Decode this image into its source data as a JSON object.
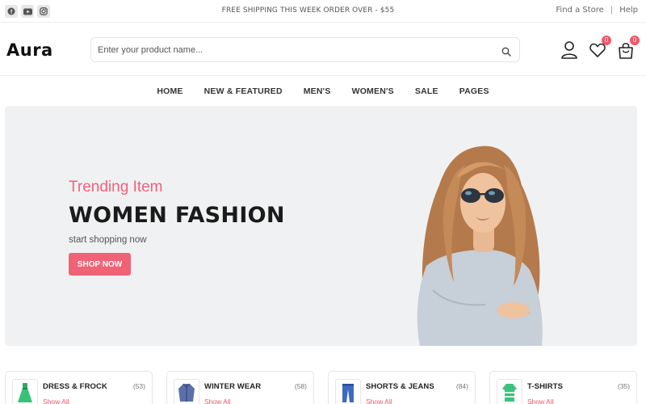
{
  "topbar": {
    "socials": [
      {
        "icon": "facebook-icon"
      },
      {
        "icon": "youtube-icon"
      },
      {
        "icon": "instagram-icon"
      }
    ],
    "shipping": "FREE SHIPPING THIS WEEK ORDER OVER - $55",
    "find_store": "Find a Store",
    "separator": "|",
    "help": "Help"
  },
  "header": {
    "logo": "Aura",
    "search_placeholder": "Enter your product name...",
    "wishlist_count": "0",
    "cart_count": "0"
  },
  "nav": {
    "items": [
      "HOME",
      "NEW & FEATURED",
      "MEN'S",
      "WOMEN'S",
      "SALE",
      "PAGES"
    ]
  },
  "hero": {
    "subtitle": "Trending Item",
    "title": "WOMEN FASHION",
    "text": "start shopping now",
    "button": "SHOP NOW"
  },
  "categories": [
    {
      "name": "DRESS & FROCK",
      "count": "(53)",
      "link": "Show All",
      "icon": "dress-icon"
    },
    {
      "name": "WINTER WEAR",
      "count": "(58)",
      "link": "Show All",
      "icon": "jacket-icon"
    },
    {
      "name": "SHORTS & JEANS",
      "count": "(84)",
      "link": "Show All",
      "icon": "jeans-icon"
    },
    {
      "name": "T-SHIRTS",
      "count": "(35)",
      "link": "Show All",
      "icon": "tshirt-icon"
    }
  ],
  "colors": {
    "accent": "#f06377",
    "hero_bg": "#f0f1f2",
    "text_dark": "#1b1b1b"
  }
}
